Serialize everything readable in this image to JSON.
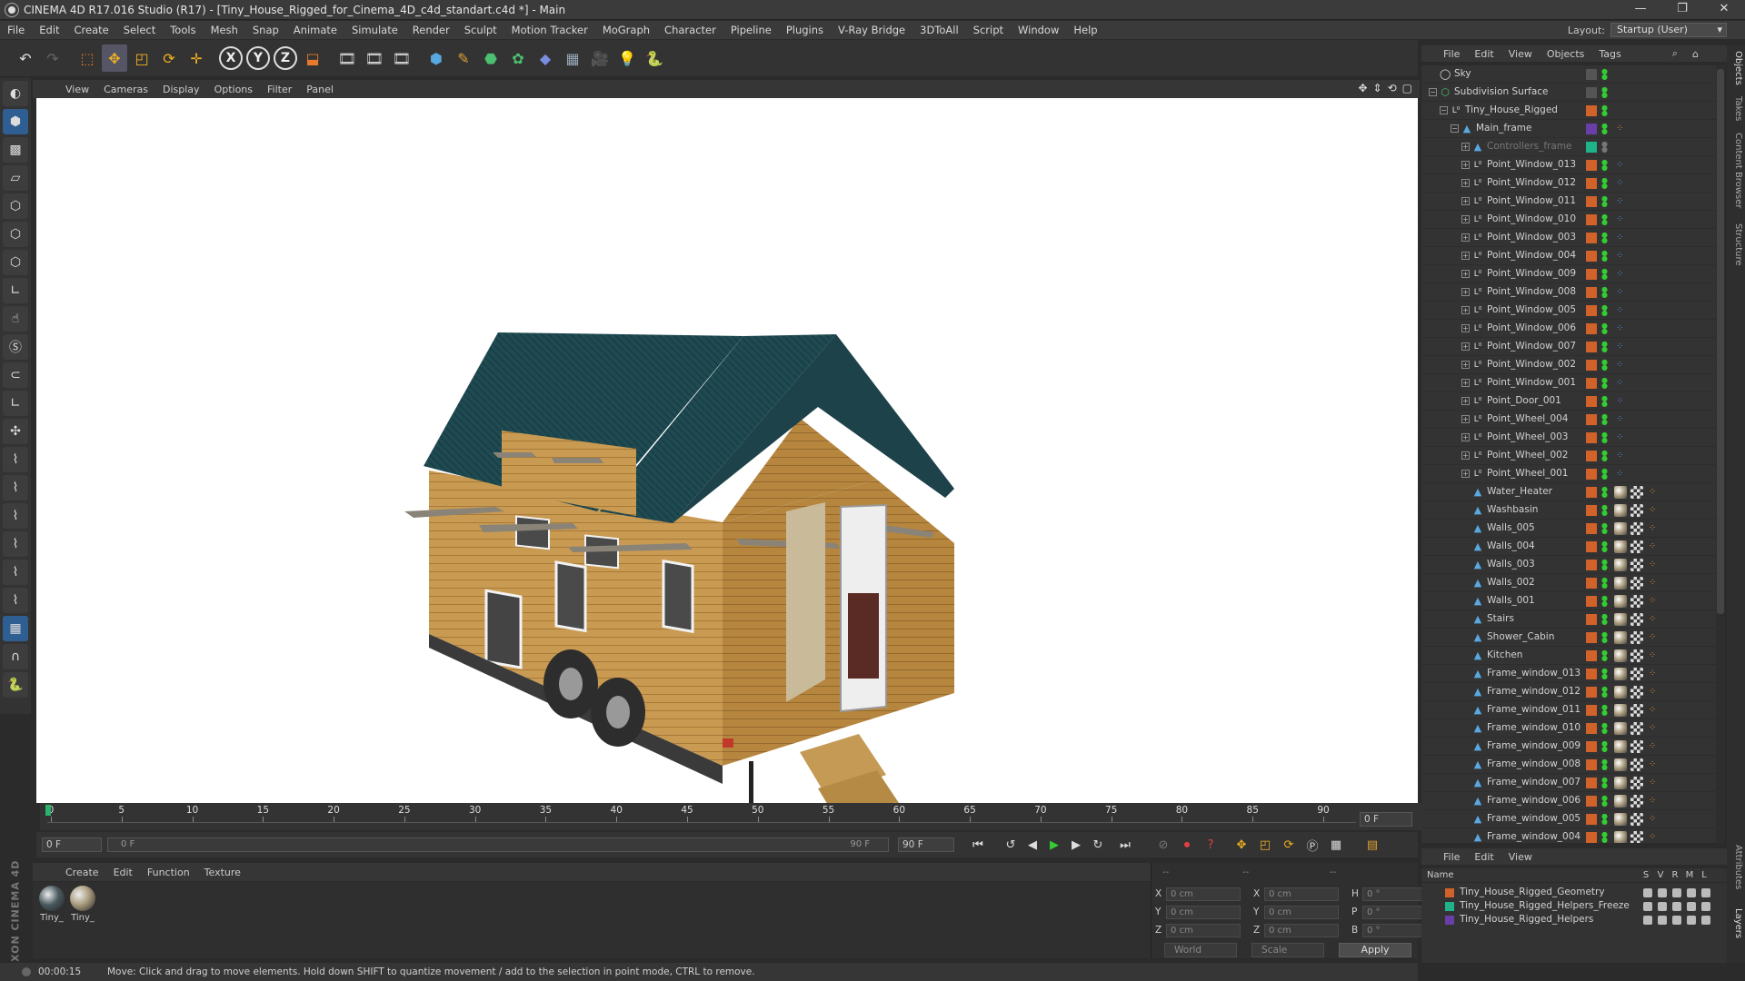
{
  "window": {
    "title": "CINEMA 4D R17.016 Studio (R17) - [Tiny_House_Rigged_for_Cinema_4D_c4d_standart.c4d *] - Main",
    "minimize": "—",
    "restore": "❐",
    "close": "✕"
  },
  "menubar": {
    "items": [
      "File",
      "Edit",
      "Create",
      "Select",
      "Tools",
      "Mesh",
      "Snap",
      "Animate",
      "Simulate",
      "Render",
      "Sculpt",
      "Motion Tracker",
      "MoGraph",
      "Character",
      "Pipeline",
      "Plugins",
      "V-Ray Bridge",
      "3DToAll",
      "Script",
      "Window",
      "Help"
    ],
    "layout_label": "Layout:",
    "layout_value": "Startup (User)"
  },
  "viewport": {
    "menu": [
      "View",
      "Cameras",
      "Display",
      "Options",
      "Filter",
      "Panel"
    ],
    "nav_icons": [
      "move-view-icon",
      "zoom-view-icon",
      "rotate-view-icon",
      "maximize-view-icon"
    ]
  },
  "timeline": {
    "ticks": [
      0,
      5,
      10,
      15,
      20,
      25,
      30,
      35,
      40,
      45,
      50,
      55,
      60,
      65,
      70,
      75,
      80,
      85,
      90
    ],
    "current_frame": "0 F",
    "start_field": "0 F",
    "scrub_start": "0 F",
    "scrub_end": "90 F",
    "end_field": "90 F"
  },
  "material_manager": {
    "menu": [
      "Create",
      "Edit",
      "Function",
      "Texture"
    ],
    "materials": [
      {
        "label": "Tiny_",
        "color": "#4a5a60"
      },
      {
        "label": "Tiny_",
        "color": "#a89a7c"
      }
    ]
  },
  "coordinates": {
    "header_left": "--",
    "header_mid": "--",
    "header_right": "--",
    "rows": [
      {
        "a": "X",
        "av": "0 cm",
        "b": "X",
        "bv": "0 cm",
        "c": "H",
        "cv": "0 °"
      },
      {
        "a": "Y",
        "av": "0 cm",
        "b": "Y",
        "bv": "0 cm",
        "c": "P",
        "cv": "0 °"
      },
      {
        "a": "Z",
        "av": "0 cm",
        "b": "Z",
        "bv": "0 cm",
        "c": "B",
        "cv": "0 °"
      }
    ],
    "space_select": "World",
    "mode_select": "Scale",
    "apply": "Apply"
  },
  "statusbar": {
    "time": "00:00:15",
    "message": "Move: Click and drag to move elements. Hold down SHIFT to quantize movement / add to the selection in point mode, CTRL to remove."
  },
  "logo": "MAXON CINEMA 4D",
  "object_manager": {
    "menu": [
      "File",
      "Edit",
      "View",
      "Objects",
      "Tags"
    ],
    "objects": [
      {
        "name": "Sky",
        "depth": 0,
        "icon": "sky-icon",
        "expand": "",
        "layer": "",
        "tags": "sky"
      },
      {
        "name": "Subdivision Surface",
        "depth": 0,
        "icon": "subdivision-icon",
        "expand": "−",
        "layer": "",
        "tags": "check"
      },
      {
        "name": "Tiny_House_Rigged",
        "depth": 1,
        "icon": "null-icon",
        "expand": "−",
        "layer": "#d0622a",
        "tags": ""
      },
      {
        "name": "Main_frame",
        "depth": 2,
        "icon": "bone-icon",
        "expand": "−",
        "layer": "#6a3ea8",
        "tags": "dot"
      },
      {
        "name": "Controllers_frame",
        "depth": 3,
        "icon": "bone-icon",
        "expand": "+",
        "layer": "#1fb38a",
        "tags": "dim",
        "dim": true
      },
      {
        "name": "Point_Window_013",
        "depth": 3,
        "icon": "null-icon",
        "expand": "+",
        "layer": "#d0622a",
        "tags": "ctrl"
      },
      {
        "name": "Point_Window_012",
        "depth": 3,
        "icon": "null-icon",
        "expand": "+",
        "layer": "#d0622a",
        "tags": "ctrl"
      },
      {
        "name": "Point_Window_011",
        "depth": 3,
        "icon": "null-icon",
        "expand": "+",
        "layer": "#d0622a",
        "tags": "ctrl"
      },
      {
        "name": "Point_Window_010",
        "depth": 3,
        "icon": "null-icon",
        "expand": "+",
        "layer": "#d0622a",
        "tags": "ctrl"
      },
      {
        "name": "Point_Window_003",
        "depth": 3,
        "icon": "null-icon",
        "expand": "+",
        "layer": "#d0622a",
        "tags": "ctrl"
      },
      {
        "name": "Point_Window_004",
        "depth": 3,
        "icon": "null-icon",
        "expand": "+",
        "layer": "#d0622a",
        "tags": "ctrl"
      },
      {
        "name": "Point_Window_009",
        "depth": 3,
        "icon": "null-icon",
        "expand": "+",
        "layer": "#d0622a",
        "tags": "ctrl"
      },
      {
        "name": "Point_Window_008",
        "depth": 3,
        "icon": "null-icon",
        "expand": "+",
        "layer": "#d0622a",
        "tags": "ctrl"
      },
      {
        "name": "Point_Window_005",
        "depth": 3,
        "icon": "null-icon",
        "expand": "+",
        "layer": "#d0622a",
        "tags": "ctrl"
      },
      {
        "name": "Point_Window_006",
        "depth": 3,
        "icon": "null-icon",
        "expand": "+",
        "layer": "#d0622a",
        "tags": "ctrl"
      },
      {
        "name": "Point_Window_007",
        "depth": 3,
        "icon": "null-icon",
        "expand": "+",
        "layer": "#d0622a",
        "tags": "ctrl"
      },
      {
        "name": "Point_Window_002",
        "depth": 3,
        "icon": "null-icon",
        "expand": "+",
        "layer": "#d0622a",
        "tags": "ctrl"
      },
      {
        "name": "Point_Window_001",
        "depth": 3,
        "icon": "null-icon",
        "expand": "+",
        "layer": "#d0622a",
        "tags": "ctrl"
      },
      {
        "name": "Point_Door_001",
        "depth": 3,
        "icon": "null-icon",
        "expand": "+",
        "layer": "#d0622a",
        "tags": "ctrl"
      },
      {
        "name": "Point_Wheel_004",
        "depth": 3,
        "icon": "null-icon",
        "expand": "+",
        "layer": "#d0622a",
        "tags": "ctrl"
      },
      {
        "name": "Point_Wheel_003",
        "depth": 3,
        "icon": "null-icon",
        "expand": "+",
        "layer": "#d0622a",
        "tags": "ctrl"
      },
      {
        "name": "Point_Wheel_002",
        "depth": 3,
        "icon": "null-icon",
        "expand": "+",
        "layer": "#d0622a",
        "tags": "ctrl"
      },
      {
        "name": "Point_Wheel_001",
        "depth": 3,
        "icon": "null-icon",
        "expand": "+",
        "layer": "#d0622a",
        "tags": "ctrl"
      },
      {
        "name": "Water_Heater",
        "depth": 3,
        "icon": "bone-icon",
        "expand": "",
        "layer": "#d0622a",
        "tags": "mat"
      },
      {
        "name": "Washbasin",
        "depth": 3,
        "icon": "bone-icon",
        "expand": "",
        "layer": "#d0622a",
        "tags": "mat"
      },
      {
        "name": "Walls_005",
        "depth": 3,
        "icon": "bone-icon",
        "expand": "",
        "layer": "#d0622a",
        "tags": "mat"
      },
      {
        "name": "Walls_004",
        "depth": 3,
        "icon": "bone-icon",
        "expand": "",
        "layer": "#d0622a",
        "tags": "mat"
      },
      {
        "name": "Walls_003",
        "depth": 3,
        "icon": "bone-icon",
        "expand": "",
        "layer": "#d0622a",
        "tags": "mat"
      },
      {
        "name": "Walls_002",
        "depth": 3,
        "icon": "bone-icon",
        "expand": "",
        "layer": "#d0622a",
        "tags": "mat"
      },
      {
        "name": "Walls_001",
        "depth": 3,
        "icon": "bone-icon",
        "expand": "",
        "layer": "#d0622a",
        "tags": "mat"
      },
      {
        "name": "Stairs",
        "depth": 3,
        "icon": "bone-icon",
        "expand": "",
        "layer": "#d0622a",
        "tags": "mat"
      },
      {
        "name": "Shower_Cabin",
        "depth": 3,
        "icon": "bone-icon",
        "expand": "",
        "layer": "#d0622a",
        "tags": "mat"
      },
      {
        "name": "Kitchen",
        "depth": 3,
        "icon": "bone-icon",
        "expand": "",
        "layer": "#d0622a",
        "tags": "mat"
      },
      {
        "name": "Frame_window_013",
        "depth": 3,
        "icon": "bone-icon",
        "expand": "",
        "layer": "#d0622a",
        "tags": "mat"
      },
      {
        "name": "Frame_window_012",
        "depth": 3,
        "icon": "bone-icon",
        "expand": "",
        "layer": "#d0622a",
        "tags": "mat"
      },
      {
        "name": "Frame_window_011",
        "depth": 3,
        "icon": "bone-icon",
        "expand": "",
        "layer": "#d0622a",
        "tags": "mat"
      },
      {
        "name": "Frame_window_010",
        "depth": 3,
        "icon": "bone-icon",
        "expand": "",
        "layer": "#d0622a",
        "tags": "mat"
      },
      {
        "name": "Frame_window_009",
        "depth": 3,
        "icon": "bone-icon",
        "expand": "",
        "layer": "#d0622a",
        "tags": "mat"
      },
      {
        "name": "Frame_window_008",
        "depth": 3,
        "icon": "bone-icon",
        "expand": "",
        "layer": "#d0622a",
        "tags": "mat"
      },
      {
        "name": "Frame_window_007",
        "depth": 3,
        "icon": "bone-icon",
        "expand": "",
        "layer": "#d0622a",
        "tags": "mat"
      },
      {
        "name": "Frame_window_006",
        "depth": 3,
        "icon": "bone-icon",
        "expand": "",
        "layer": "#d0622a",
        "tags": "mat"
      },
      {
        "name": "Frame_window_005",
        "depth": 3,
        "icon": "bone-icon",
        "expand": "",
        "layer": "#d0622a",
        "tags": "mat"
      },
      {
        "name": "Frame_window_004",
        "depth": 3,
        "icon": "bone-icon",
        "expand": "",
        "layer": "#d0622a",
        "tags": "mat"
      }
    ]
  },
  "layer_manager": {
    "menu": [
      "File",
      "Edit",
      "View"
    ],
    "columns": [
      "Name",
      "S",
      "V",
      "R",
      "M",
      "L"
    ],
    "layers": [
      {
        "name": "Tiny_House_Rigged_Geometry",
        "color": "#d0622a"
      },
      {
        "name": "Tiny_House_Rigged_Helpers_Freeze",
        "color": "#1fb38a"
      },
      {
        "name": "Tiny_House_Rigged_Helpers",
        "color": "#6a3ea8"
      }
    ]
  },
  "side_tabs": [
    "Objects",
    "Takes",
    "Content Browser",
    "Structure",
    "Attributes",
    "Layers"
  ]
}
